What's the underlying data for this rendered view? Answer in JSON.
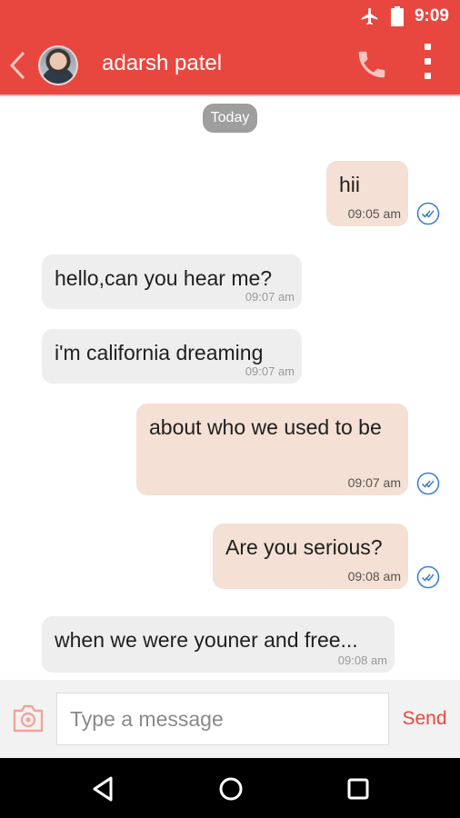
{
  "status_bar": {
    "time": "9:09",
    "icons": [
      "airplane-icon",
      "battery-icon"
    ]
  },
  "header": {
    "contact_name": "adarsh patel",
    "icons": [
      "back-icon",
      "avatar",
      "phone-icon",
      "more-vert-icon"
    ]
  },
  "chat": {
    "date_chip": "Today",
    "messages": [
      {
        "direction": "outgoing",
        "text": "hii",
        "time": "09:05 am",
        "read": true
      },
      {
        "direction": "incoming",
        "text": "hello,can you hear me?",
        "time": "09:07 am"
      },
      {
        "direction": "incoming",
        "text": "i'm california dreaming",
        "time": "09:07 am"
      },
      {
        "direction": "outgoing",
        "text": "about who we used to be",
        "time": "09:07 am",
        "read": true
      },
      {
        "direction": "outgoing",
        "text": "Are you serious?",
        "time": "09:08 am",
        "read": true
      },
      {
        "direction": "incoming",
        "text": "when we were youner and free...",
        "time": "09:08 am"
      }
    ]
  },
  "composer": {
    "placeholder": "Type a message",
    "value": "",
    "send_label": "Send",
    "icons": [
      "camera-icon"
    ]
  },
  "nav_bar": {
    "icons": [
      "back-triangle-icon",
      "home-circle-icon",
      "recents-square-icon"
    ]
  },
  "colors": {
    "accent": "#e8473f",
    "outgoing_bubble": "#f4e0d4",
    "incoming_bubble": "#eeeeee",
    "read_tick": "#3b82d6"
  }
}
